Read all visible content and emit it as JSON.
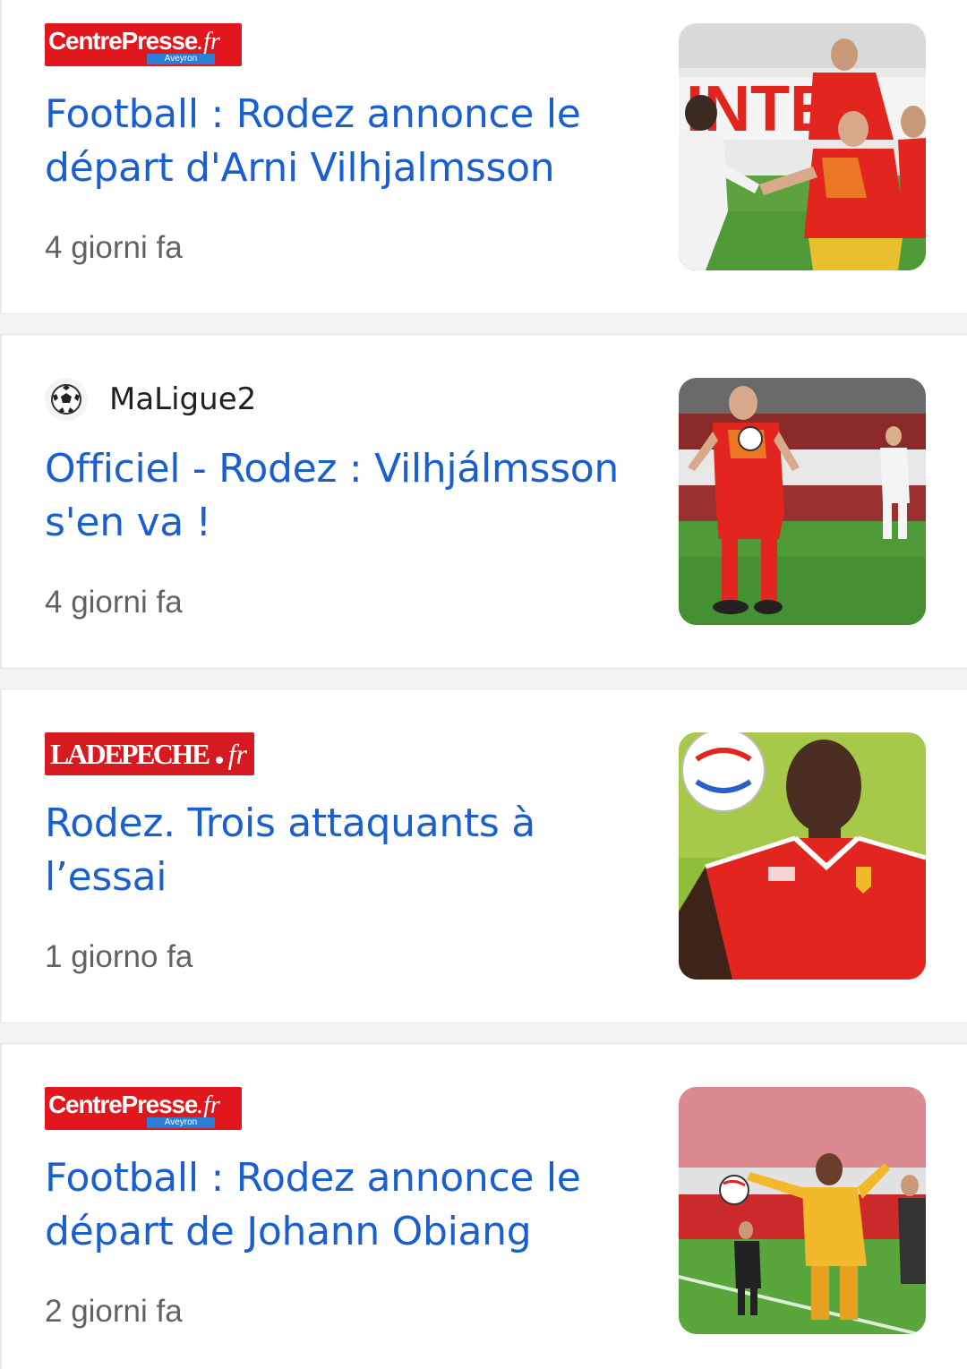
{
  "feed": {
    "articles": [
      {
        "source": {
          "type": "logo",
          "logo_name": "CentrePresse",
          "logo_suffix": ".fr",
          "logo_sub": "Aveyron"
        },
        "title": "Football : Rodez annonce le départ d'Arni Vilhjalmsson",
        "time": "4 giorni fa",
        "thumbnail": "football-players-match-image"
      },
      {
        "source": {
          "type": "text",
          "name": "MaLigue2",
          "icon": "soccer-ball-icon"
        },
        "title": "Officiel - Rodez : Vilhjálmsson s'en va !",
        "time": "4 giorni fa",
        "thumbnail": "football-player-controlling-ball-image"
      },
      {
        "source": {
          "type": "logo",
          "logo_name": "LADEPECHE",
          "logo_suffix": "fr"
        },
        "title": "Rodez. Trois attaquants à l’essai",
        "time": "1 giorno fa",
        "thumbnail": "football-player-portrait-image"
      },
      {
        "source": {
          "type": "logo",
          "logo_name": "CentrePresse",
          "logo_suffix": ".fr",
          "logo_sub": "Aveyron"
        },
        "title": "Football : Rodez annonce le départ de Johann Obiang",
        "time": "2 giorni fa",
        "thumbnail": "football-player-receiving-ball-image"
      }
    ]
  },
  "colors": {
    "title": "#1a5fd0",
    "time": "#5f6368",
    "separator": "#f1f3f4",
    "centrepresse_red": "#e2161d",
    "ladepeche_red": "#d71920",
    "team_red": "#e2261f",
    "team_yellow": "#f2b92a",
    "pitch_green": "#4d9a36"
  }
}
